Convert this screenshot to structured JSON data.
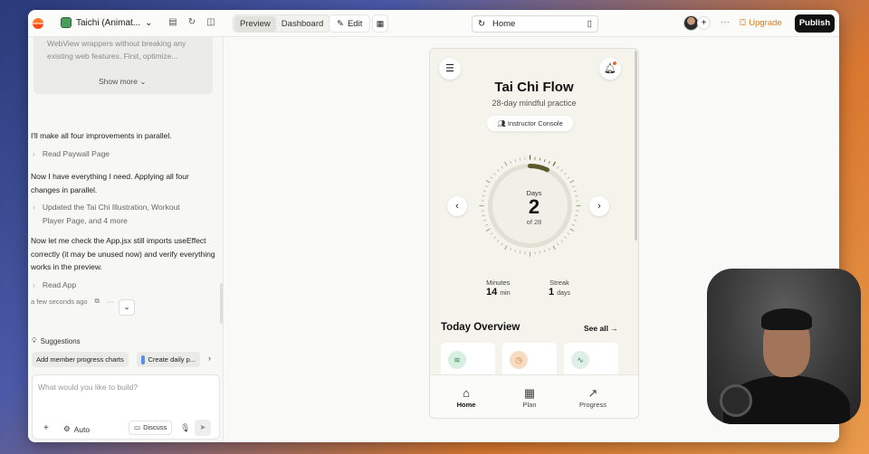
{
  "topbar": {
    "project_name": "Taichi (Animat...",
    "preview_tab": "Preview",
    "dashboard_tab": "Dashboard",
    "edit_label": "Edit",
    "url": "Home",
    "upgrade_label": "Upgrade",
    "publish_label": "Publish",
    "more_label": "···"
  },
  "chat": {
    "summary_lines": [
      "WebView wrappers without breaking any",
      "existing web features. First, optimize..."
    ],
    "show_more": "Show more",
    "messages": [
      "I'll make all four improvements in parallel.",
      "Now I have everything I need. Applying all four changes in parallel.",
      "Now let me check the App.jsx still imports useEffect correctly (it may be unused now) and verify everything works in the preview."
    ],
    "tools": [
      "Read Paywall Page",
      "Updated the Tai Chi Illustration, Workout Player Page, and 4 more",
      "Read App"
    ],
    "timestamp": "a few seconds ago",
    "suggestions_title": "Suggestions",
    "suggestions": [
      "Add member progress charts",
      "Create daily p..."
    ],
    "composer_placeholder": "What would you like to build?",
    "auto_label": "Auto",
    "discuss_label": "Discuss"
  },
  "app": {
    "title": "Tai Chi Flow",
    "subtitle": "28-day mindful practice",
    "instructor_button": "Instructor Console",
    "days_label": "Days",
    "days_value": "2",
    "days_total": "of 28",
    "progress_fraction": 0.071,
    "minutes_label": "Minutes",
    "minutes_value": "14",
    "minutes_unit": "min",
    "streak_label": "Streak",
    "streak_value": "1",
    "streak_unit": "days",
    "overview_title": "Today Overview",
    "see_all": "See all →",
    "tabs": [
      "Home",
      "Plan",
      "Progress"
    ]
  },
  "colors": {
    "accent_orange": "#e07a10",
    "publish_bg": "#111111",
    "progress_arc": "#5a5a2a"
  }
}
